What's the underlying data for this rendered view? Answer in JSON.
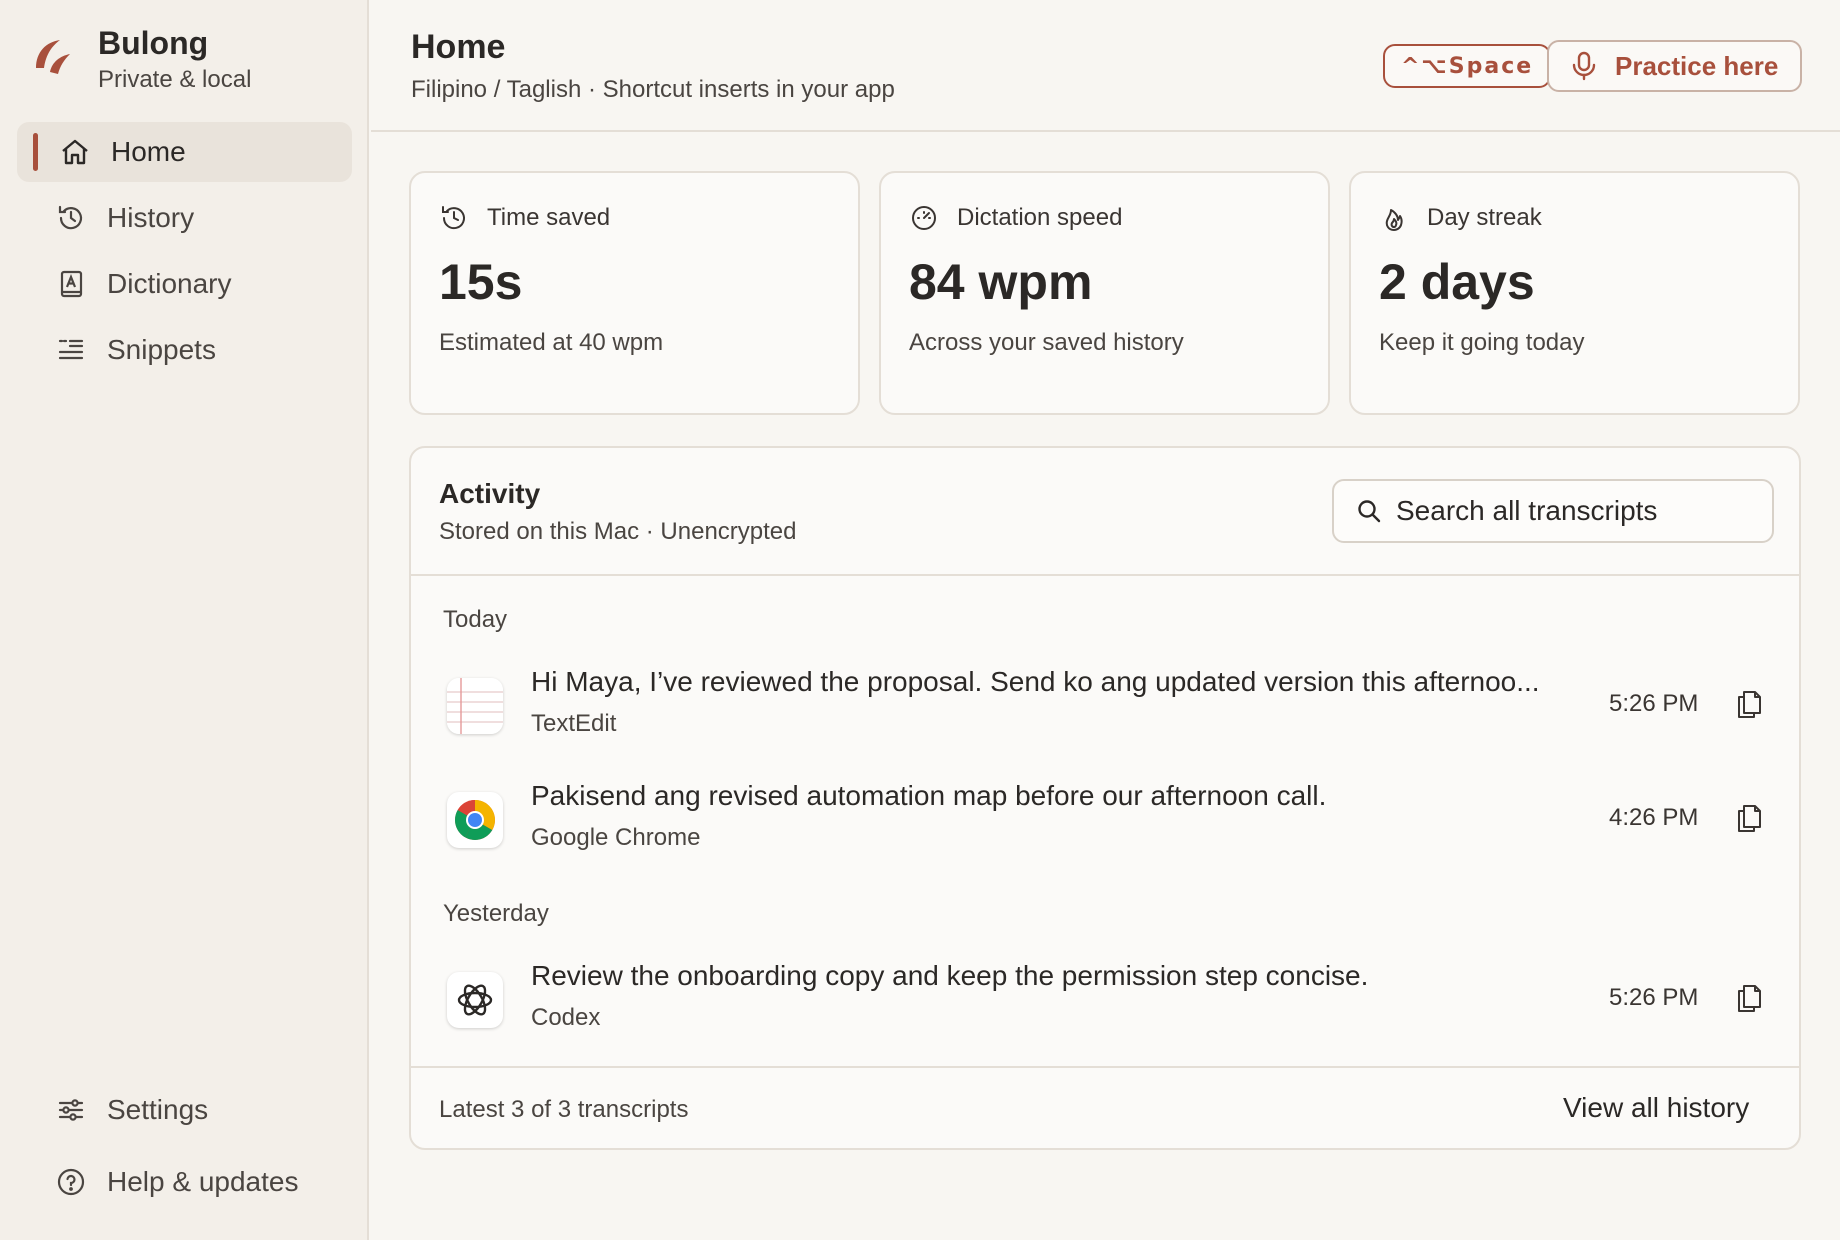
{
  "app": {
    "name": "Bulong",
    "tagline": "Private & local",
    "accent": "#a8503c"
  },
  "sidebar": {
    "items": [
      {
        "label": "Home",
        "icon": "home-icon",
        "active": true
      },
      {
        "label": "History",
        "icon": "history-icon"
      },
      {
        "label": "Dictionary",
        "icon": "dictionary-icon"
      },
      {
        "label": "Snippets",
        "icon": "snippets-icon"
      }
    ],
    "bottom": [
      {
        "label": "Settings",
        "icon": "sliders-icon"
      },
      {
        "label": "Help & updates",
        "icon": "help-icon"
      }
    ]
  },
  "header": {
    "title": "Home",
    "subtitle": "Filipino / Taglish · Shortcut inserts in your app",
    "shortcut": "^⌥Space",
    "practice_label": "Practice here"
  },
  "stats": [
    {
      "label": "Time saved",
      "value": "15s",
      "note": "Estimated at 40 wpm",
      "icon": "clock-rewind-icon"
    },
    {
      "label": "Dictation speed",
      "value": "84 wpm",
      "note": "Across your saved history",
      "icon": "speedometer-icon"
    },
    {
      "label": "Day streak",
      "value": "2 days",
      "note": "Keep it going today",
      "icon": "flame-icon"
    }
  ],
  "activity": {
    "title": "Activity",
    "subtitle": "Stored on this Mac · Unencrypted",
    "search_placeholder": "Search all transcripts",
    "groups": [
      {
        "label": "Today",
        "rows": [
          {
            "text": "Hi Maya, I’ve reviewed the proposal. Send ko ang updated version this afternoo...",
            "app": "TextEdit",
            "time": "5:26 PM",
            "icon": "textedit-icon"
          },
          {
            "text": "Pakisend ang revised automation map before our afternoon call.",
            "app": "Google Chrome",
            "time": "4:26 PM",
            "icon": "chrome-icon"
          }
        ]
      },
      {
        "label": "Yesterday",
        "rows": [
          {
            "text": "Review the onboarding copy and keep the permission step concise.",
            "app": "Codex",
            "time": "5:26 PM",
            "icon": "codex-icon"
          }
        ]
      }
    ],
    "footer_note": "Latest 3 of 3 transcripts",
    "view_all": "View all history"
  }
}
